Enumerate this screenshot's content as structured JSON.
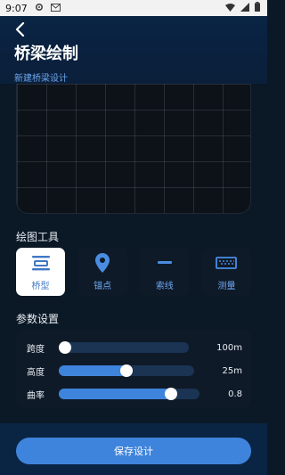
{
  "status_bar": {
    "time": "9:07",
    "icons": [
      "settings-icon",
      "mail-icon",
      "wifi-icon",
      "signal-icon",
      "battery-icon"
    ]
  },
  "header": {
    "title": "桥梁绘制",
    "subtitle": "新建桥梁设计",
    "back_icon": "chevron-left-icon"
  },
  "tools_section": {
    "title": "绘图工具",
    "items": [
      {
        "label": "桥型",
        "icon": "bridge-type-icon",
        "active": true
      },
      {
        "label": "锚点",
        "icon": "location-pin-icon",
        "active": false
      },
      {
        "label": "索线",
        "icon": "cable-line-icon",
        "active": false
      },
      {
        "label": "测量",
        "icon": "ruler-icon",
        "active": false
      }
    ]
  },
  "params_section": {
    "title": "参数设置",
    "items": [
      {
        "label": "跨度",
        "value": "100m",
        "level": 0.0
      },
      {
        "label": "高度",
        "value": "25m",
        "level": 0.5
      },
      {
        "label": "曲率",
        "value": "0.8",
        "level": 0.8
      }
    ]
  },
  "save_button": {
    "label": "保存设计"
  },
  "colors": {
    "background": "#0b1826",
    "header": "#0a2444",
    "accent": "#3f84dc",
    "accent_text": "#6ea7f0",
    "panel": "#0f1a28"
  }
}
